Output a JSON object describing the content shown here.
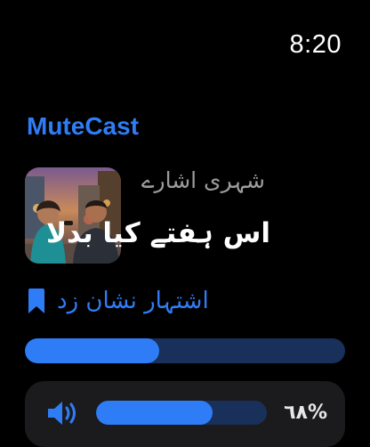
{
  "status_bar": {
    "time": "8:20"
  },
  "app": {
    "title": "MuteCast"
  },
  "now_playing": {
    "artwork_icon": "podcast-artwork-image",
    "podcast_name": "شہری اشارے",
    "episode_title": "اس ہفتے کیا بدلا"
  },
  "bookmark": {
    "icon": "bookmark-icon",
    "label": "اشتہار نشان زد"
  },
  "playback": {
    "progress_fraction": 0.42
  },
  "volume": {
    "icon": "speaker-icon",
    "level_fraction": 0.68,
    "display": "٦٨%"
  },
  "colors": {
    "accent": "#2f7df6",
    "track": "#18305a",
    "card": "#1b1b1d",
    "background": "#000000",
    "secondary_text": "#9c9c9c"
  }
}
